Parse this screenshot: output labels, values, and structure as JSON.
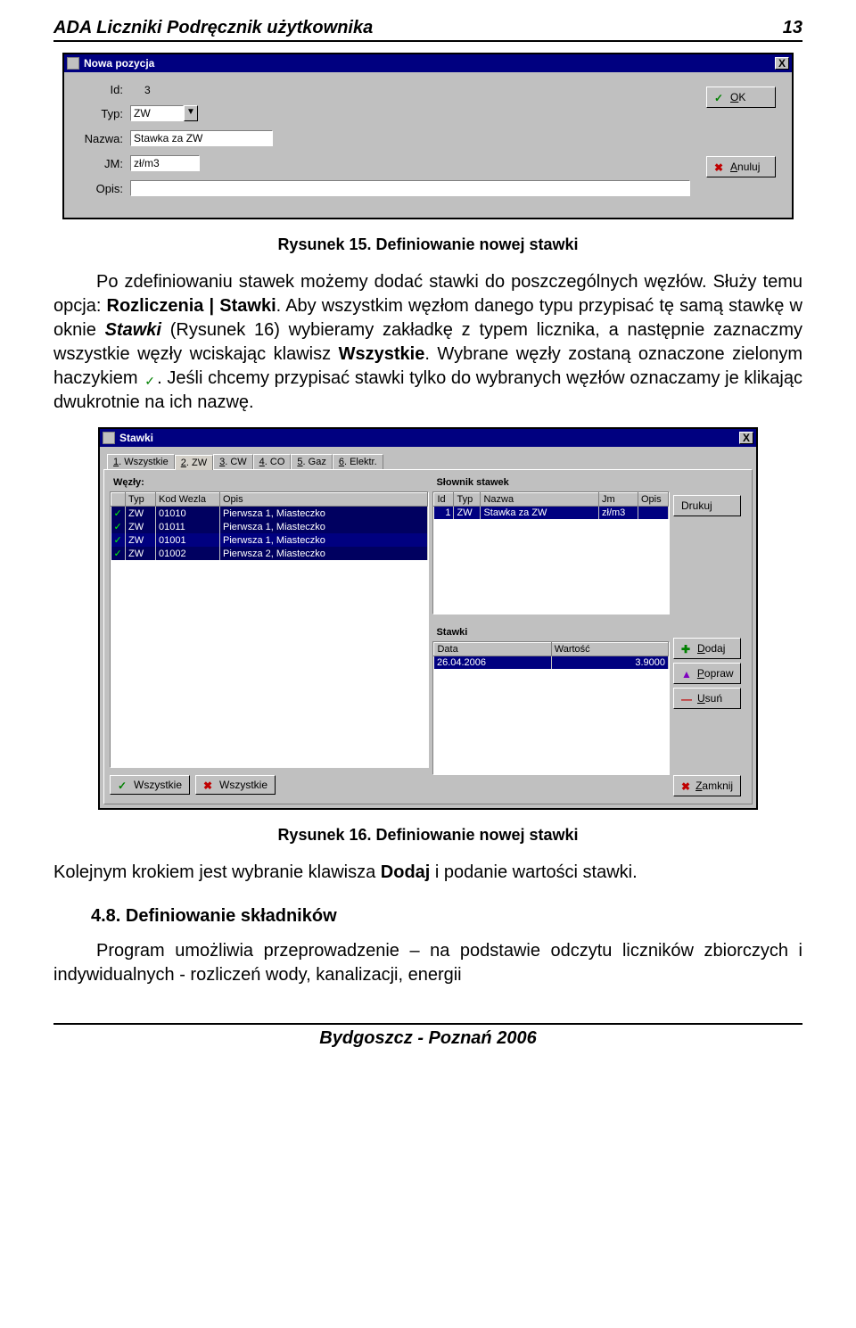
{
  "header": {
    "title": "ADA Liczniki Podręcznik użytkownika",
    "page": "13"
  },
  "footer": {
    "text": "Bydgoszcz - Poznań 2006"
  },
  "dialog1": {
    "title": "Nowa pozycja",
    "close": "X",
    "labels": {
      "id": "Id:",
      "type": "Typ:",
      "name": "Nazwa:",
      "jm": "JM:",
      "opis": "Opis:"
    },
    "values": {
      "id": "3",
      "type": "ZW",
      "name": "Stawka za ZW",
      "jm": "zł/m3",
      "opis": ""
    },
    "buttons": {
      "ok": "OK",
      "ok_u": "O",
      "cancel": "Anuluj",
      "cancel_u": "A"
    }
  },
  "caption1": "Rysunek 15. Definiowanie nowej stawki",
  "para1_a": "Po zdefiniowaniu stawek możemy dodać stawki do poszczególnych węzłów. Służy temu opcja: ",
  "para1_b": "Rozliczenia | Stawki",
  "para1_c": ". Aby wszystkim węzłom danego typu przypisać tę samą stawkę w oknie ",
  "para1_d": "Stawki",
  "para1_e": " (Rysunek 16) wybieramy zakładkę z typem licznika, a następnie zaznaczmy wszystkie węzły wciskając klawisz ",
  "para1_f": "Wszystkie",
  "para1_g": ". Wybrane węzły zostaną oznaczone zielonym haczykiem ",
  "para1_h": ". Jeśli chcemy przypisać stawki tylko do wybranych węzłów oznaczamy je klikając dwukrotnie na ich nazwę.",
  "dialog2": {
    "title": "Stawki",
    "close": "X",
    "tabs": [
      {
        "u": "1",
        "label": ". Wszystkie"
      },
      {
        "u": "2",
        "label": ". ZW"
      },
      {
        "u": "3",
        "label": ". CW"
      },
      {
        "u": "4",
        "label": ". CO"
      },
      {
        "u": "5",
        "label": ". Gaz"
      },
      {
        "u": "6",
        "label": ". Elektr."
      }
    ],
    "wezly_title": "Węzły:",
    "wezly_headers": [
      "",
      "Typ",
      "Kod Wezla",
      "Opis"
    ],
    "wezly_rows": [
      {
        "chk": "✓",
        "typ": "ZW",
        "kod": "01010",
        "opis": "Pierwsza 1, Miasteczko"
      },
      {
        "chk": "✓",
        "typ": "ZW",
        "kod": "01011",
        "opis": "Pierwsza 1, Miasteczko"
      },
      {
        "chk": "✓",
        "typ": "ZW",
        "kod": "01001",
        "opis": "Pierwsza 1, Miasteczko"
      },
      {
        "chk": "✓",
        "typ": "ZW",
        "kod": "01002",
        "opis": "Pierwsza 2, Miasteczko"
      }
    ],
    "slownik_title": "Słownik stawek",
    "slownik_headers": [
      "Id",
      "Typ",
      "Nazwa",
      "Jm",
      "Opis"
    ],
    "slownik_row": {
      "id": "1",
      "typ": "ZW",
      "nazwa": "Stawka za ZW",
      "jm": "zł/m3",
      "opis": ""
    },
    "stawki_title": "Stawki",
    "stawki_headers": [
      "Data",
      "Wartość"
    ],
    "stawki_row": {
      "data": "26.04.2006",
      "wartosc": "3.9000"
    },
    "btn_drukuj": "Drukuj",
    "btn_dodaj": "Dodaj",
    "btn_dodaj_u": "D",
    "btn_popraw": "Popraw",
    "btn_popraw_u": "P",
    "btn_usun": "Usuń",
    "btn_usun_u": "U",
    "btn_zamknij": "Zamknij",
    "btn_zamknij_u": "Z",
    "btn_wszystkie_on": "Wszystkie",
    "btn_wszystkie_off": "Wszystkie"
  },
  "caption2": "Rysunek 16. Definiowanie nowej stawki",
  "para2_a": "Kolejnym krokiem jest wybranie klawisza ",
  "para2_b": "Dodaj",
  "para2_c": " i podanie wartości stawki.",
  "section": "4.8. Definiowanie składników",
  "para3": "Program umożliwia przeprowadzenie – na podstawie odczytu liczników zbiorczych i indywidualnych - rozliczeń wody, kanalizacji, energii"
}
